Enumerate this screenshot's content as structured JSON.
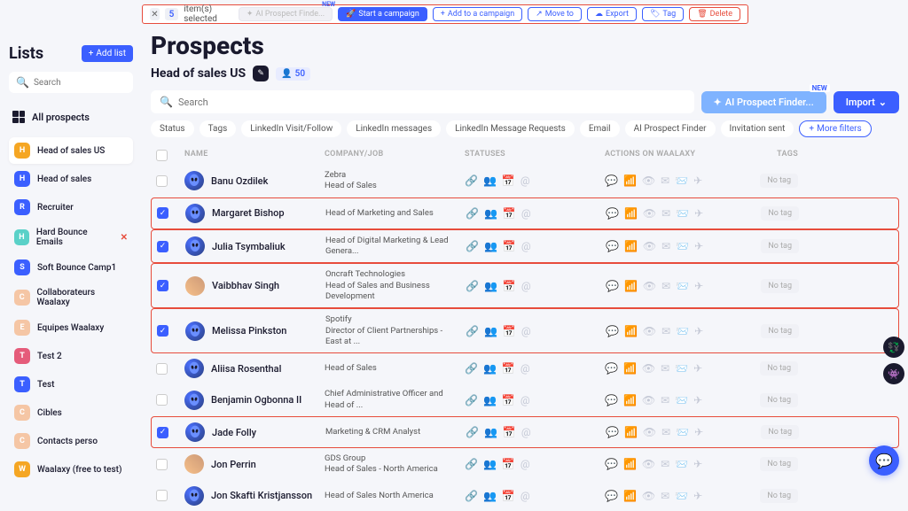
{
  "actionBar": {
    "count": "5",
    "label": "item(s) selected",
    "aiFinder": "AI Prospect Finde...",
    "newBadge": "NEW",
    "start": "Start a campaign",
    "add": "Add to a campaign",
    "move": "Move to",
    "export": "Export",
    "tag": "Tag",
    "delete": "Delete"
  },
  "sidebar": {
    "title": "Lists",
    "addList": "Add list",
    "searchPlaceholder": "Search",
    "allProspects": "All prospects",
    "items": [
      {
        "initial": "H",
        "color": "#f5a623",
        "label": "Head of sales US",
        "active": true
      },
      {
        "initial": "H",
        "color": "#3b5fff",
        "label": "Head of sales"
      },
      {
        "initial": "R",
        "color": "#3b5fff",
        "label": "Recruiter"
      },
      {
        "initial": "H",
        "color": "#5ad1c8",
        "label": "Hard Bounce Emails",
        "redX": true
      },
      {
        "initial": "S",
        "color": "#3b5fff",
        "label": "Soft Bounce Camp1"
      },
      {
        "initial": "C",
        "color": "#f5c6a5",
        "label": "Collaborateurs Waalaxy"
      },
      {
        "initial": "E",
        "color": "#f5c6a5",
        "label": "Equipes Waalaxy"
      },
      {
        "initial": "T",
        "color": "#e55b7a",
        "label": "Test 2"
      },
      {
        "initial": "T",
        "color": "#3b5fff",
        "label": "Test"
      },
      {
        "initial": "C",
        "color": "#f5c6a5",
        "label": "Cibles"
      },
      {
        "initial": "C",
        "color": "#f5c6a5",
        "label": "Contacts perso"
      },
      {
        "initial": "W",
        "color": "#f5a623",
        "label": "Waalaxy (free to test)"
      }
    ]
  },
  "main": {
    "title": "Prospects",
    "subtitle": "Head of sales US",
    "count": "50",
    "searchPlaceholder": "Search",
    "aiFinder": "AI Prospect Finder...",
    "newBadge": "NEW",
    "import": "Import",
    "filters": [
      "Status",
      "Tags",
      "LinkedIn Visit/Follow",
      "LinkedIn messages",
      "LinkedIn Message Requests",
      "Email",
      "AI Prospect Finder",
      "Invitation sent"
    ],
    "moreFilters": "More filters"
  },
  "table": {
    "headers": {
      "name": "NAME",
      "company": "COMPANY/JOB",
      "statuses": "STATUSES",
      "actions": "ACTIONS ON WAALAXY",
      "tags": "TAGS"
    },
    "noTag": "No tag",
    "rows": [
      {
        "checked": false,
        "highlight": false,
        "avatar": "alien",
        "name": "Banu Ozdilek",
        "company": "Zebra",
        "job": "Head of Sales"
      },
      {
        "checked": true,
        "highlight": true,
        "avatar": "alien",
        "name": "Margaret Bishop",
        "company": "",
        "job": "Head of Marketing and Sales"
      },
      {
        "checked": true,
        "highlight": true,
        "avatar": "alien",
        "name": "Julia Tsymbaliuk",
        "company": "",
        "job": "Head of Digital Marketing & Lead Genera..."
      },
      {
        "checked": true,
        "highlight": true,
        "avatar": "photo",
        "name": "Vaibbhav Singh",
        "company": "Oncraft Technologies",
        "job": "Head of Sales and Business Development"
      },
      {
        "checked": true,
        "highlight": true,
        "avatar": "alien",
        "name": "Melissa Pinkston",
        "company": "Spotify",
        "job": "Director of Client Partnerships - East at ..."
      },
      {
        "checked": false,
        "highlight": false,
        "avatar": "alien",
        "name": "Aliisa Rosenthal",
        "company": "",
        "job": "Head of Sales"
      },
      {
        "checked": false,
        "highlight": false,
        "avatar": "alien",
        "name": "Benjamin Ogbonna II",
        "company": "",
        "job": "Chief Administrative Officer and Head of ..."
      },
      {
        "checked": true,
        "highlight": true,
        "avatar": "alien",
        "name": "Jade Folly",
        "company": "",
        "job": "Marketing & CRM Analyst"
      },
      {
        "checked": false,
        "highlight": false,
        "avatar": "photo",
        "name": "Jon Perrin",
        "company": "GDS Group",
        "job": "Head of Sales - North America"
      },
      {
        "checked": false,
        "highlight": false,
        "avatar": "alien",
        "name": "Jon Skafti Kristjansson",
        "company": "",
        "job": "Head of Sales North America"
      }
    ]
  }
}
